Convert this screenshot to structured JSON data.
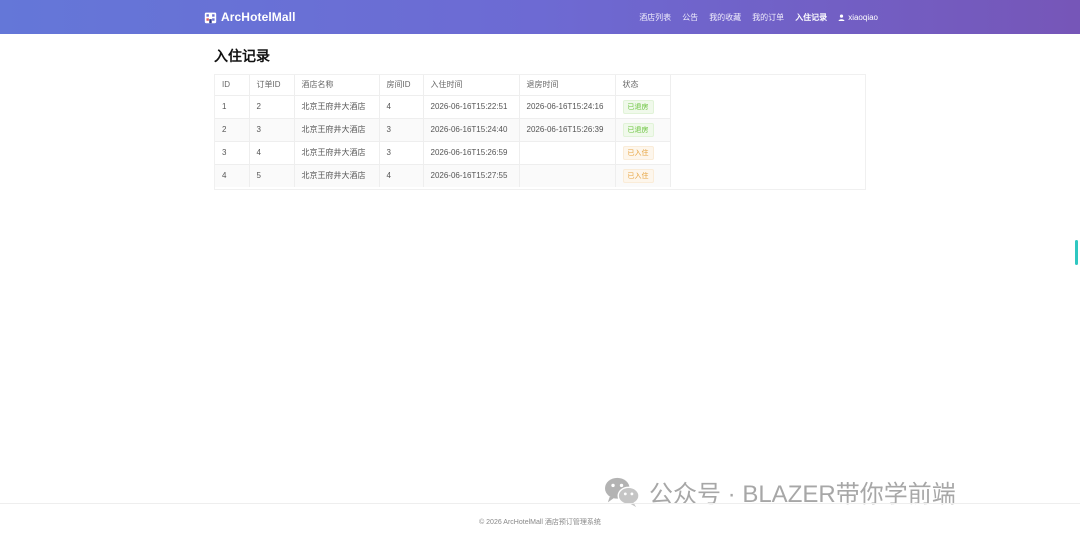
{
  "navbar": {
    "brand": "ArcHotelMall",
    "items": [
      {
        "label": "酒店列表",
        "active": false
      },
      {
        "label": "公告",
        "active": false
      },
      {
        "label": "我的收藏",
        "active": false
      },
      {
        "label": "我的订单",
        "active": false
      },
      {
        "label": "入住记录",
        "active": true
      }
    ],
    "username": "xiaoqiao"
  },
  "page": {
    "title": "入住记录"
  },
  "table": {
    "headers": [
      "ID",
      "订单ID",
      "酒店名称",
      "房间ID",
      "入住时间",
      "退房时间",
      "状态"
    ],
    "rows": [
      {
        "id": "1",
        "order_id": "2",
        "hotel": "北京王府井大酒店",
        "room_id": "4",
        "check_in": "2026-06-16T15:22:51",
        "check_out": "2026-06-16T15:24:16",
        "status": "已退房",
        "status_type": "checked-out"
      },
      {
        "id": "2",
        "order_id": "3",
        "hotel": "北京王府井大酒店",
        "room_id": "3",
        "check_in": "2026-06-16T15:24:40",
        "check_out": "2026-06-16T15:26:39",
        "status": "已退房",
        "status_type": "checked-out"
      },
      {
        "id": "3",
        "order_id": "4",
        "hotel": "北京王府井大酒店",
        "room_id": "3",
        "check_in": "2026-06-16T15:26:59",
        "check_out": "",
        "status": "已入住",
        "status_type": "checked-in"
      },
      {
        "id": "4",
        "order_id": "5",
        "hotel": "北京王府井大酒店",
        "room_id": "4",
        "check_in": "2026-06-16T15:27:55",
        "check_out": "",
        "status": "已入住",
        "status_type": "checked-in"
      }
    ]
  },
  "footer": {
    "text": "© 2026 ArcHotelMall 酒店预订管理系统"
  },
  "watermark": {
    "text": "公众号 · BLAZER带你学前端"
  },
  "colors": {
    "nav_gradient_start": "#6477d8",
    "nav_gradient_end": "#7656b8",
    "tag_success": "#67c23a",
    "tag_warning": "#e6a23c"
  }
}
